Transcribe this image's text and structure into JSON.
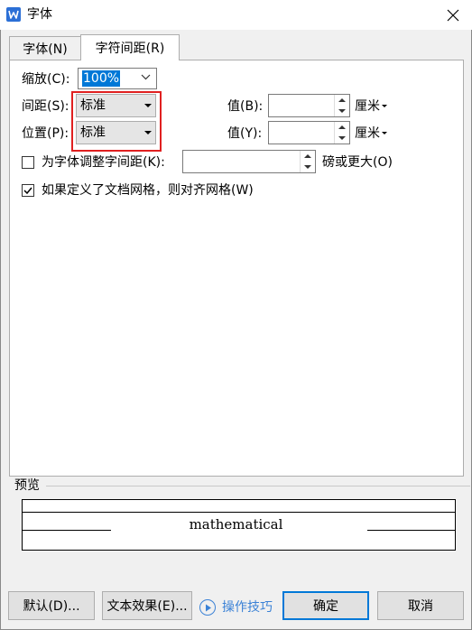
{
  "window": {
    "title": "字体",
    "app_icon": "wps-writer-icon",
    "close_icon": "close-icon"
  },
  "tabs": [
    {
      "label": "字体(N)",
      "active": false
    },
    {
      "label": "字符间距(R)",
      "active": true
    }
  ],
  "form": {
    "scale": {
      "label": "缩放(C):",
      "value": "100%"
    },
    "spacing": {
      "label": "间距(S):",
      "value": "标准",
      "amount_label": "值(B):",
      "amount_value": "",
      "unit": "厘米"
    },
    "position": {
      "label": "位置(P):",
      "value": "标准",
      "amount_label": "值(Y):",
      "amount_value": "",
      "unit": "厘米"
    },
    "kerning": {
      "label": "为字体调整字间距(K):",
      "checked": false,
      "value": "",
      "suffix": "磅或更大(O)"
    },
    "grid": {
      "label": "如果定义了文档网格，则对齐网格(W)",
      "checked": true
    }
  },
  "preview": {
    "label": "预览",
    "sample": "mathematical"
  },
  "buttons": {
    "default": "默认(D)...",
    "text_effects": "文本效果(E)...",
    "tips": "操作技巧",
    "ok": "确定",
    "cancel": "取消"
  },
  "colors": {
    "highlight_red": "#e02020",
    "accent_blue": "#0078d7",
    "link_blue": "#3b82d6"
  }
}
